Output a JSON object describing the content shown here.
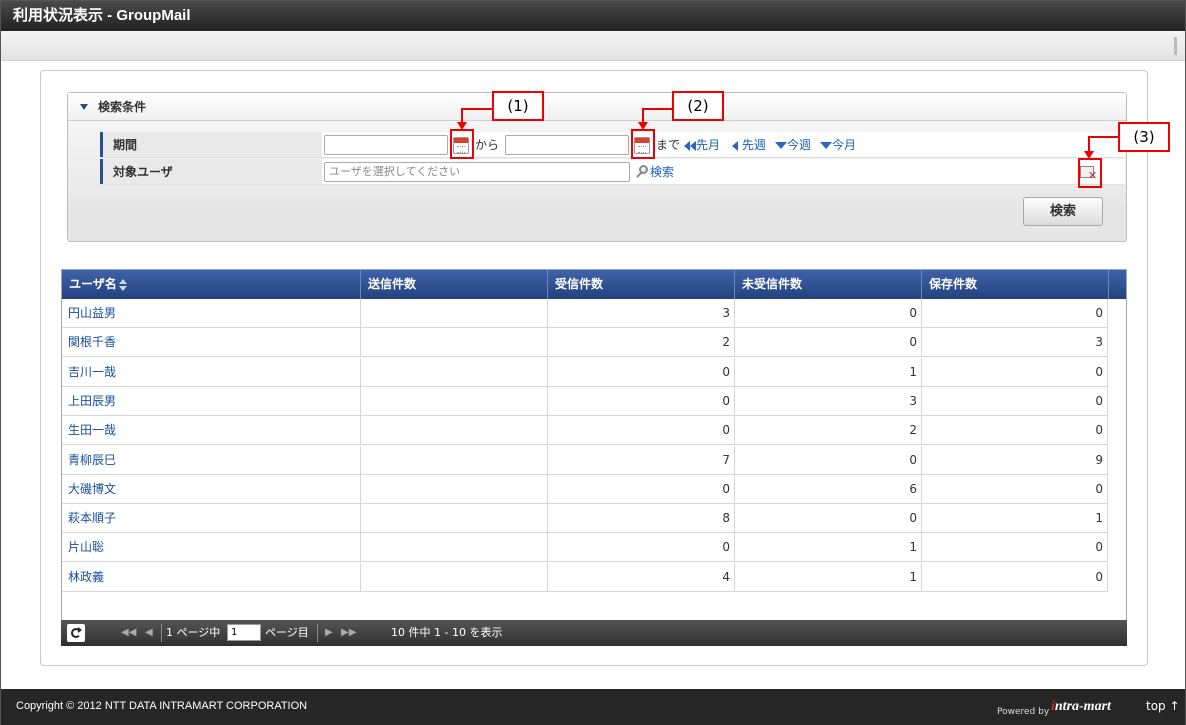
{
  "window": {
    "title": "利用状況表示 - GroupMail"
  },
  "search_panel": {
    "header": "検索条件",
    "period_label": "期間",
    "from_value": "",
    "to_value": "",
    "from_text": "から",
    "until_text": "まで",
    "nav": {
      "prev_month": "先月",
      "prev_week": "先週",
      "this_week": "今週",
      "this_month": "今月"
    },
    "user_label": "対象ユーザ",
    "user_placeholder": "ユーザを選択してください",
    "user_search_link": "検索",
    "search_button": "検索"
  },
  "callouts": [
    "(1)",
    "(2)",
    "(3)"
  ],
  "table": {
    "columns": [
      "ユーザ名",
      "送信件数",
      "受信件数",
      "未受信件数",
      "保存件数"
    ],
    "rows": [
      {
        "name": "円山益男",
        "sent": "",
        "received": "3",
        "unreceived": "0",
        "saved": "0"
      },
      {
        "name": "関根千香",
        "sent": "",
        "received": "2",
        "unreceived": "0",
        "saved": "3"
      },
      {
        "name": "吉川一哉",
        "sent": "",
        "received": "0",
        "unreceived": "1",
        "saved": "0"
      },
      {
        "name": "上田辰男",
        "sent": "",
        "received": "0",
        "unreceived": "3",
        "saved": "0"
      },
      {
        "name": "生田一哉",
        "sent": "",
        "received": "0",
        "unreceived": "2",
        "saved": "0"
      },
      {
        "name": "青柳辰巳",
        "sent": "",
        "received": "7",
        "unreceived": "0",
        "saved": "9"
      },
      {
        "name": "大磯博文",
        "sent": "",
        "received": "0",
        "unreceived": "6",
        "saved": "0"
      },
      {
        "name": "萩本順子",
        "sent": "",
        "received": "8",
        "unreceived": "0",
        "saved": "1"
      },
      {
        "name": "片山聡",
        "sent": "",
        "received": "0",
        "unreceived": "1",
        "saved": "0"
      },
      {
        "name": "林政義",
        "sent": "",
        "received": "4",
        "unreceived": "1",
        "saved": "0"
      }
    ]
  },
  "pager": {
    "page_prefix": "1 ページ中",
    "page_value": "1",
    "page_suffix": "ページ目",
    "summary": "10 件中 1 - 10 を表示"
  },
  "footer": {
    "copyright": "Copyright © 2012 NTT DATA INTRAMART CORPORATION",
    "powered_by": "Powered by",
    "logo_i": "i",
    "logo_rest": "ntra-mart",
    "top_link": "top ↑"
  }
}
